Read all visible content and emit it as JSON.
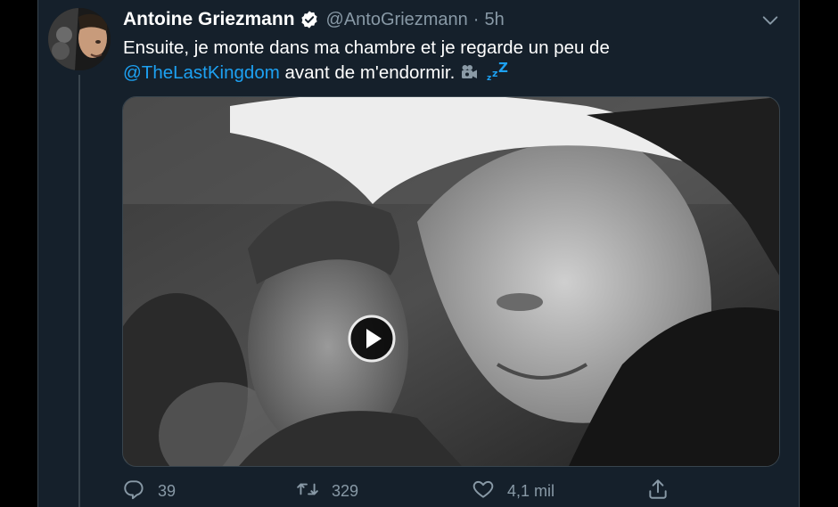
{
  "tweet": {
    "author_name": "Antoine Griezmann",
    "handle": "@AntoGriezmann",
    "separator": "·",
    "time": "5h",
    "text_part1": "Ensuite, je monte dans ma chambre et je regarde un peu de",
    "mention": "@TheLastKingdom",
    "text_part2": "avant de m'endormir."
  },
  "media": {
    "type": "video",
    "play_icon": "play-icon"
  },
  "actions": {
    "reply_count": "39",
    "retweet_count": "329",
    "like_count": "4,1 mil"
  },
  "icons": {
    "verified": "verified-badge-icon",
    "caret": "chevron-down-icon",
    "reply": "reply-icon",
    "retweet": "retweet-icon",
    "like": "heart-icon",
    "share": "share-icon"
  },
  "colors": {
    "background": "#15202b",
    "text": "#ffffff",
    "muted": "#8899a6",
    "accent": "#1da1f2",
    "border": "#38444d"
  }
}
